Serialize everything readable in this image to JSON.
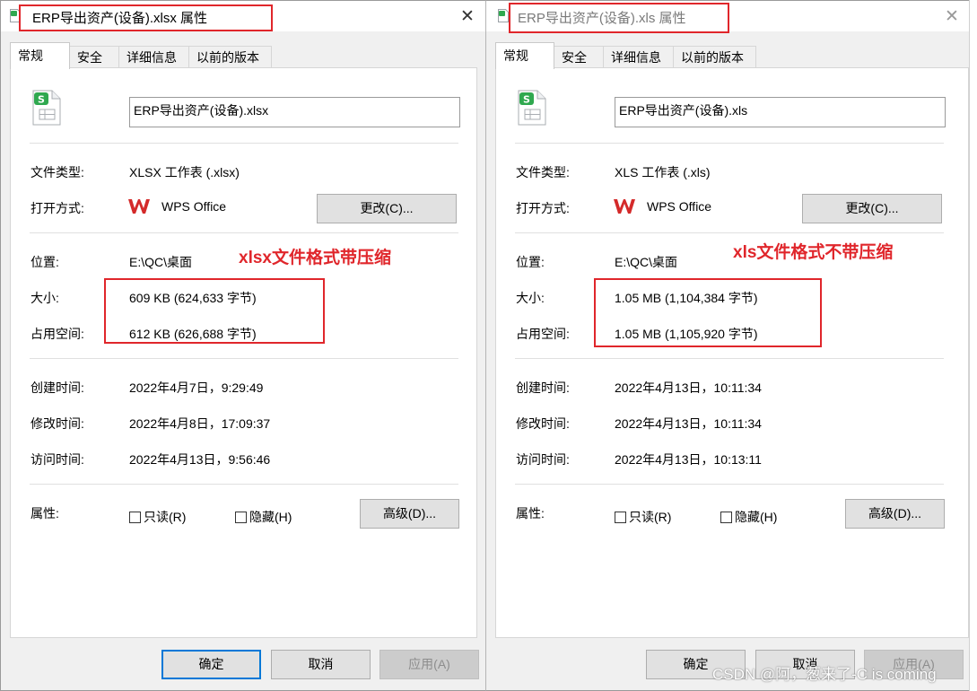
{
  "left": {
    "title": "ERP导出资产(设备).xlsx 属性",
    "tabs": [
      "常规",
      "安全",
      "详细信息",
      "以前的版本"
    ],
    "filename": "ERP导出资产(设备).xlsx",
    "labels": {
      "type": "文件类型:",
      "opens_with": "打开方式:",
      "location": "位置:",
      "size": "大小:",
      "size_on_disk": "占用空间:",
      "created": "创建时间:",
      "modified": "修改时间:",
      "accessed": "访问时间:",
      "attributes": "属性:"
    },
    "values": {
      "type": "XLSX 工作表 (.xlsx)",
      "app": "WPS Office",
      "location": "E:\\QC\\桌面",
      "size": "609 KB (624,633 字节)",
      "size_on_disk": "612 KB (626,688 字节)",
      "created": "2022年4月7日，9:29:49",
      "modified": "2022年4月8日，17:09:37",
      "accessed": "2022年4月13日，9:56:46"
    },
    "buttons": {
      "change": "更改(C)...",
      "advanced": "高级(D)..."
    },
    "checkboxes": {
      "readonly": "只读(R)",
      "hidden": "隐藏(H)"
    },
    "annotation": "xlsx文件格式带压缩",
    "footer": {
      "ok": "确定",
      "cancel": "取消",
      "apply": "应用(A)"
    }
  },
  "right": {
    "title": "ERP导出资产(设备).xls 属性",
    "tabs": [
      "常规",
      "安全",
      "详细信息",
      "以前的版本"
    ],
    "filename": "ERP导出资产(设备).xls",
    "labels": {
      "type": "文件类型:",
      "opens_with": "打开方式:",
      "location": "位置:",
      "size": "大小:",
      "size_on_disk": "占用空间:",
      "created": "创建时间:",
      "modified": "修改时间:",
      "accessed": "访问时间:",
      "attributes": "属性:"
    },
    "values": {
      "type": "XLS 工作表 (.xls)",
      "app": "WPS Office",
      "location": "E:\\QC\\桌面",
      "size": "1.05 MB (1,104,384 字节)",
      "size_on_disk": "1.05 MB (1,105,920 字节)",
      "created": "2022年4月13日，10:11:34",
      "modified": "2022年4月13日，10:11:34",
      "accessed": "2022年4月13日，10:13:11"
    },
    "buttons": {
      "change": "更改(C)...",
      "advanced": "高级(D)..."
    },
    "checkboxes": {
      "readonly": "只读(R)",
      "hidden": "隐藏(H)"
    },
    "annotation": "xls文件格式不带压缩",
    "footer": {
      "ok": "确定",
      "cancel": "取消",
      "apply": "应用(A)"
    }
  },
  "icons": {
    "file": "spreadsheet-file-icon",
    "app": "wps-office-logo-icon",
    "close": "close-icon"
  },
  "colors": {
    "annotation_red": "#e0262b",
    "focus_blue": "#0078d7",
    "wps_red": "#d42a2a",
    "sheet_green": "#2fa84f"
  },
  "watermark": "CSDN @阿，葱来了-C is coming"
}
